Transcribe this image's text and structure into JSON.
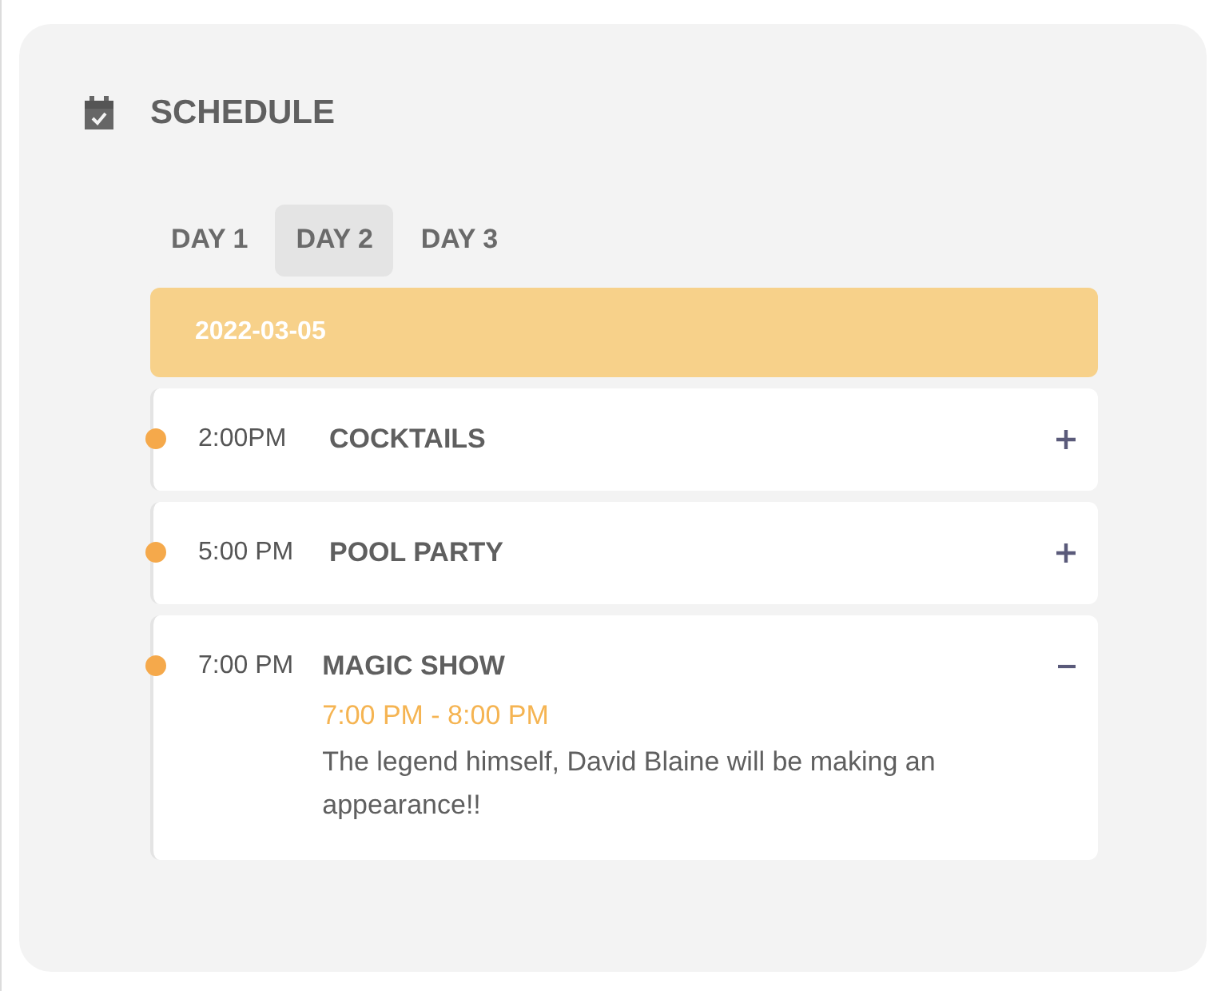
{
  "title": "SCHEDULE",
  "tabs": [
    {
      "label": "DAY 1",
      "selected": false
    },
    {
      "label": "DAY 2",
      "selected": true
    },
    {
      "label": "DAY 3",
      "selected": false
    }
  ],
  "date": "2022-03-05",
  "events": [
    {
      "time": "2:00PM",
      "name": "COCKTAILS",
      "expanded": false
    },
    {
      "time": "5:00 PM",
      "name": "POOL PARTY",
      "expanded": false
    },
    {
      "time": "7:00 PM",
      "name": "MAGIC SHOW",
      "expanded": true,
      "range": "7:00 PM - 8:00 PM",
      "description": "The legend himself, David Blaine will be making an appearance!!"
    }
  ]
}
